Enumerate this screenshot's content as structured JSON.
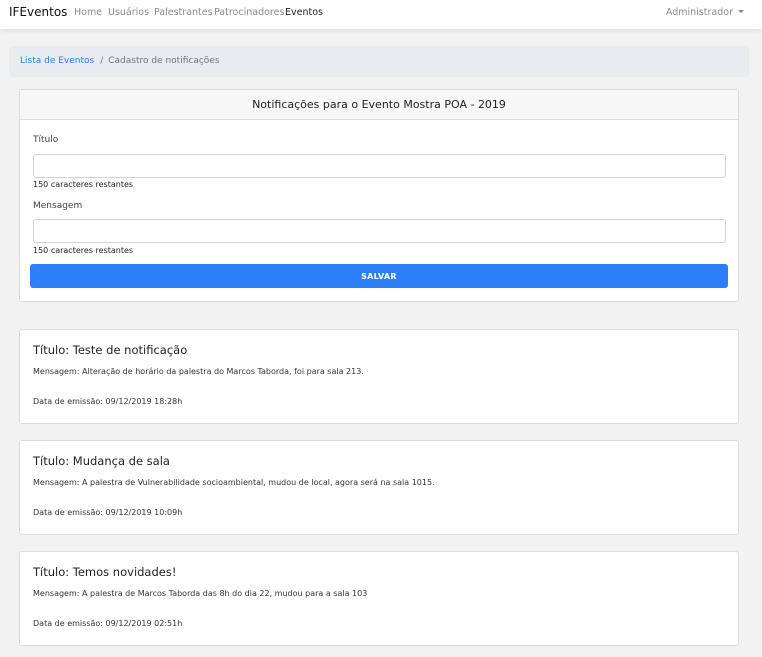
{
  "nav": {
    "brand": "IFEventos",
    "links": [
      "Home",
      "Usuários",
      "Palestrantes",
      "Patrocinadores",
      "Eventos"
    ],
    "active": "Eventos",
    "user_menu": "Administrador"
  },
  "breadcrumb": {
    "parent": "Lista de Eventos",
    "separator": "/",
    "current": "Cadastro de notificações"
  },
  "form": {
    "header": "Notificações para o Evento Mostra POA - 2019",
    "title_label": "Título",
    "title_value": "",
    "title_counter": "150 caracteres restantes",
    "message_label": "Mensagem",
    "message_value": "",
    "message_counter": "150 caracteres restantes",
    "save_label": "SALVAR"
  },
  "notifications": [
    {
      "title": "Título: Teste de notificação",
      "message": "Mensagem: Alteração de horário da palestra do Marcos Taborda, foi para sala 213.",
      "date": "Data de emissão: 09/12/2019 18:28h"
    },
    {
      "title": "Título: Mudança de sala",
      "message": "Mensagem: A palestra de Vulnerabilidade socioambiental, mudou de local, agora será na sala 1015.",
      "date": "Data de emissão: 09/12/2019 10:09h"
    },
    {
      "title": "Título: Temos novidades!",
      "message": "Mensagem: A palestra de Marcos Taborda das 8h do dia 22, mudou para a sala 103",
      "date": "Data de emissão: 09/12/2019 02:51h"
    }
  ],
  "colors": {
    "accent": "#2d7ff9",
    "link": "#2b7ce8",
    "page_background": "#f2f2f2"
  }
}
